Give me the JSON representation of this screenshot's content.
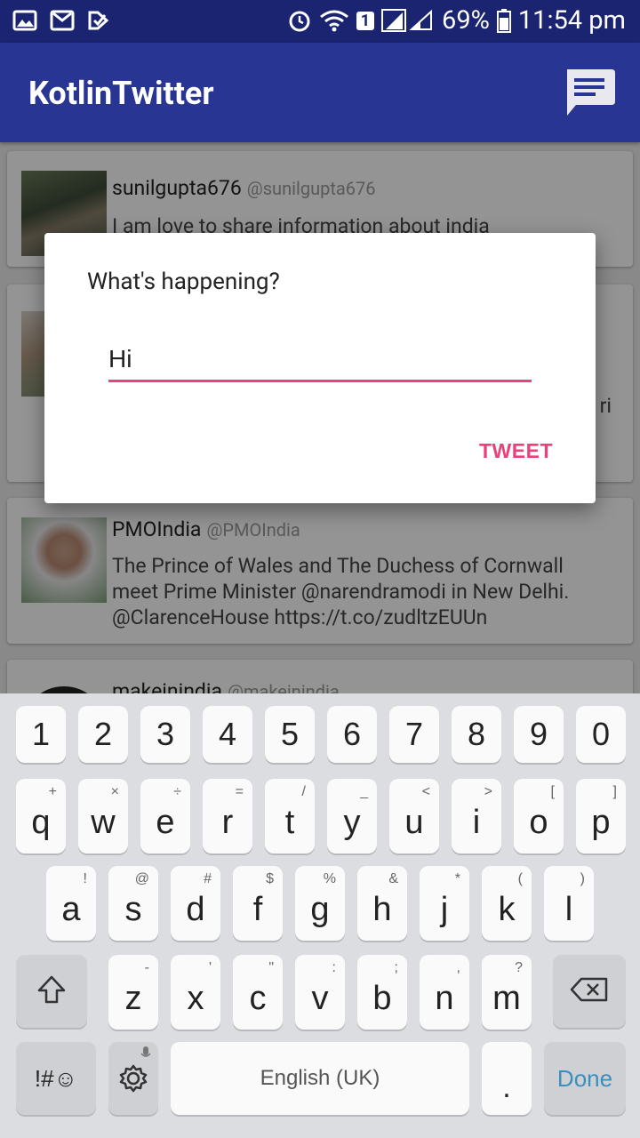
{
  "status_bar": {
    "time": "11:54 pm",
    "battery": "69%",
    "sim_slot": "1",
    "left_icons": [
      "image-icon",
      "mail-icon",
      "check-icon"
    ]
  },
  "app": {
    "title": "KotlinTwitter",
    "compose_icon": "compose-message-icon",
    "brand_color": "#283593",
    "accent_color": "#ec407a"
  },
  "tweets": [
    {
      "name": "sunilgupta676",
      "handle": "@sunilgupta676",
      "text": "I am love to share information about india"
    },
    {
      "name": "",
      "handle": "",
      "text": "",
      "visible_fragment": "ri"
    },
    {
      "name": "PMOIndia",
      "handle": "@PMOIndia",
      "text": "The Prince of Wales and The Duchess of Cornwall meet Prime Minister @narendramodi in New Delhi. @ClarenceHouse https://t.co/zudltzEUUn"
    },
    {
      "name": "makeinindia",
      "handle": "@makeinindia",
      "text": ""
    }
  ],
  "dialog": {
    "title": "What's happening?",
    "input_value": "Hi",
    "submit_label": "TWEET"
  },
  "keyboard": {
    "numbers": [
      "1",
      "2",
      "3",
      "4",
      "5",
      "6",
      "7",
      "8",
      "9",
      "0"
    ],
    "row1": [
      {
        "k": "q",
        "h": "+"
      },
      {
        "k": "w",
        "h": "×"
      },
      {
        "k": "e",
        "h": "÷"
      },
      {
        "k": "r",
        "h": "="
      },
      {
        "k": "t",
        "h": "/"
      },
      {
        "k": "y",
        "h": "_"
      },
      {
        "k": "u",
        "h": "<"
      },
      {
        "k": "i",
        "h": ">"
      },
      {
        "k": "o",
        "h": "["
      },
      {
        "k": "p",
        "h": "]"
      }
    ],
    "row2": [
      {
        "k": "a",
        "h": "!"
      },
      {
        "k": "s",
        "h": "@"
      },
      {
        "k": "d",
        "h": "#"
      },
      {
        "k": "f",
        "h": "$"
      },
      {
        "k": "g",
        "h": "%"
      },
      {
        "k": "h",
        "h": "&"
      },
      {
        "k": "j",
        "h": "*"
      },
      {
        "k": "k",
        "h": "("
      },
      {
        "k": "l",
        "h": ")"
      }
    ],
    "row3": [
      {
        "k": "z",
        "h": "-"
      },
      {
        "k": "x",
        "h": "'"
      },
      {
        "k": "c",
        "h": "\""
      },
      {
        "k": "v",
        "h": ":"
      },
      {
        "k": "b",
        "h": ";"
      },
      {
        "k": "n",
        "h": ","
      },
      {
        "k": "m",
        "h": "?"
      }
    ],
    "symbols_label": "!#☺",
    "space_label": "English (UK)",
    "period_label": ".",
    "done_label": "Done",
    "shift_icon": "shift-icon",
    "backspace_icon": "backspace-icon",
    "settings_icon": "settings-icon"
  }
}
